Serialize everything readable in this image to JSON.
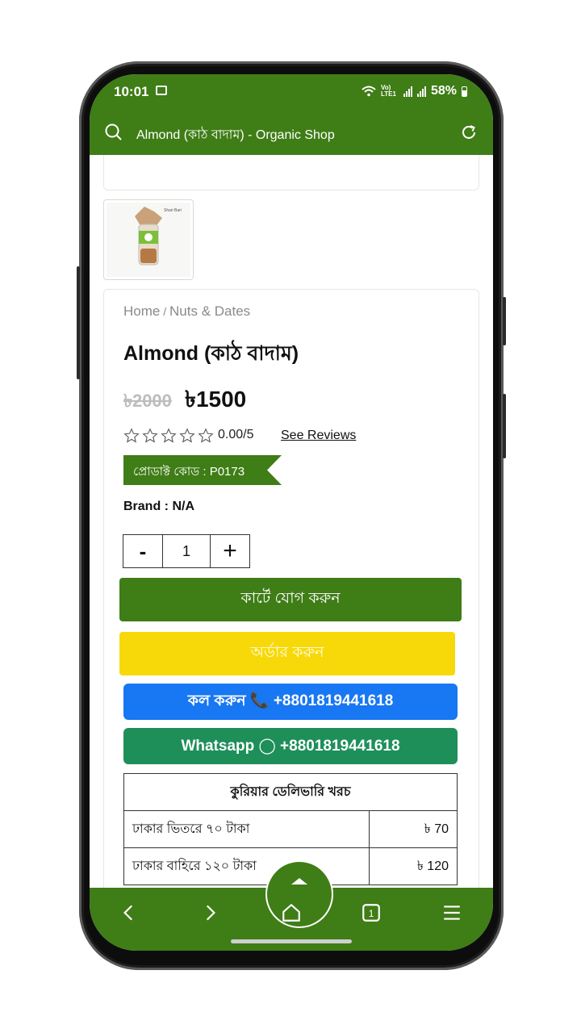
{
  "statusbar": {
    "time": "10:01",
    "battery": "58%",
    "volte": "Vo) LTE1"
  },
  "urlbar": {
    "title": "Almond (কাঠ বাদাম) - Organic Shop"
  },
  "product": {
    "breadcrumb_home": "Home",
    "breadcrumb_sep": " / ",
    "breadcrumb_category": "Nuts & Dates",
    "title": "Almond (কাঠ বাদাম)",
    "old_price": "৳2000",
    "new_price": "৳1500",
    "rating_text": "0.00/5",
    "rating_value": 0,
    "rating_max": 5,
    "see_reviews": "See Reviews",
    "product_code": "প্রোডাক্ট কোড : P0173",
    "brand": "Brand : N/A",
    "thumbnail_label": "Shari Bari"
  },
  "quantity": {
    "minus": "-",
    "value": "1",
    "plus": "+"
  },
  "buttons": {
    "add_to_cart": "কার্টে যোগ করুন",
    "order": "অর্ডার করুন",
    "call": "কল করুন 📞 +8801819441618",
    "whatsapp": "Whatsapp ◯ +8801819441618"
  },
  "shipping": {
    "header": "কুরিয়ার ডেলিভারি খরচ",
    "rows": [
      {
        "label": "ঢাকার ভিতরে ৭০ টাকা",
        "price": "৳ 70"
      },
      {
        "label": "ঢাকার বাহিরে ১২০ টাকা",
        "price": "৳ 120"
      }
    ]
  },
  "colors": {
    "brand_green": "#3f7d16",
    "order_yellow": "#f7d90a",
    "call_blue": "#1877f2",
    "whatsapp_green": "#1f8f5a"
  },
  "icons": [
    "search-icon",
    "reload-icon",
    "back-icon",
    "forward-icon",
    "home-icon",
    "tabs-icon",
    "menu-icon",
    "star-icon",
    "phone-icon",
    "whatsapp-icon"
  ]
}
